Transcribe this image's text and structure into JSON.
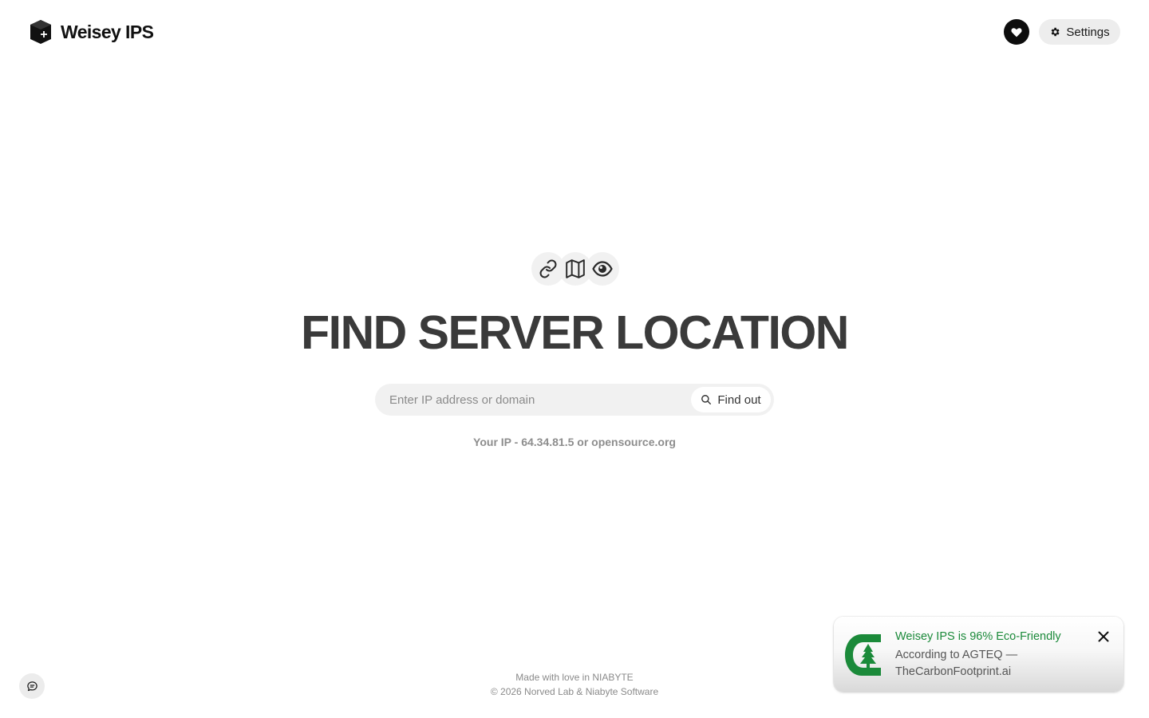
{
  "header": {
    "brand_name": "Weisey IPS",
    "logo_icon": "cube-logo-icon",
    "favorite_icon": "heart-icon",
    "settings_label": "Settings",
    "settings_icon": "gear-icon"
  },
  "hero": {
    "icons": [
      "link-icon",
      "map-icon",
      "eye-icon"
    ],
    "title": "FIND SERVER LOCATION"
  },
  "search": {
    "placeholder": "Enter IP address or domain",
    "value": "",
    "button_label": "Find out",
    "button_icon": "search-icon"
  },
  "your_ip": {
    "prefix": "Your IP - ",
    "ip": "64.34.81.5",
    "separator": " or ",
    "domain": "opensource.org"
  },
  "footer": {
    "line1": "Made with love in NIABYTE",
    "line2": "© 2026 Norved Lab & Niabyte Software"
  },
  "feedback": {
    "icon": "chat-feedback-icon"
  },
  "eco_toast": {
    "title": "Weisey IPS is 96% Eco-Friendly",
    "line1": "According to AGTEQ —",
    "line2": "TheCarbonFootprint.ai",
    "logo_icon": "carbon-tree-logo-icon",
    "close_icon": "close-icon",
    "colors": {
      "accent_green": "#1b8a3a"
    }
  }
}
